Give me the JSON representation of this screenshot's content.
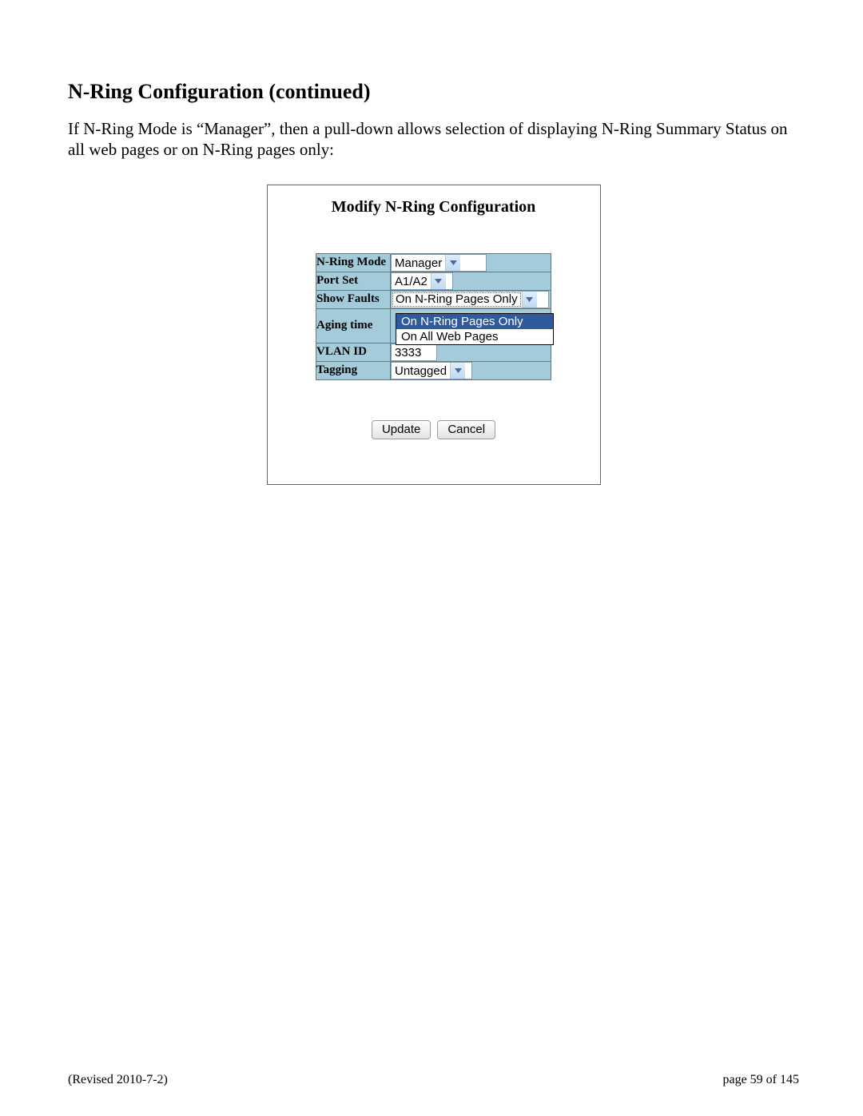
{
  "section_title": "N-Ring Configuration (continued)",
  "body_text": "If N-Ring Mode is “Manager”, then a pull-down allows selection of displaying N-Ring Summary Status on all web pages or on N-Ring pages only:",
  "panel": {
    "title": "Modify N-Ring Configuration",
    "rows": {
      "mode": {
        "label": "N-Ring Mode",
        "value": "Manager"
      },
      "port_set": {
        "label": "Port Set",
        "value": "A1/A2"
      },
      "show_faults": {
        "label": "Show Faults",
        "value": "On N-Ring Pages Only",
        "options": [
          "On N-Ring Pages Only",
          "On All Web Pages"
        ]
      },
      "aging": {
        "label": "Aging time"
      },
      "vlan": {
        "label": "VLAN ID",
        "value": "3333"
      },
      "tagging": {
        "label": "Tagging",
        "value": "Untagged"
      }
    },
    "buttons": {
      "update": "Update",
      "cancel": "Cancel"
    }
  },
  "footer": {
    "revised": "(Revised 2010-7-2)",
    "page": "page 59 of 145"
  }
}
